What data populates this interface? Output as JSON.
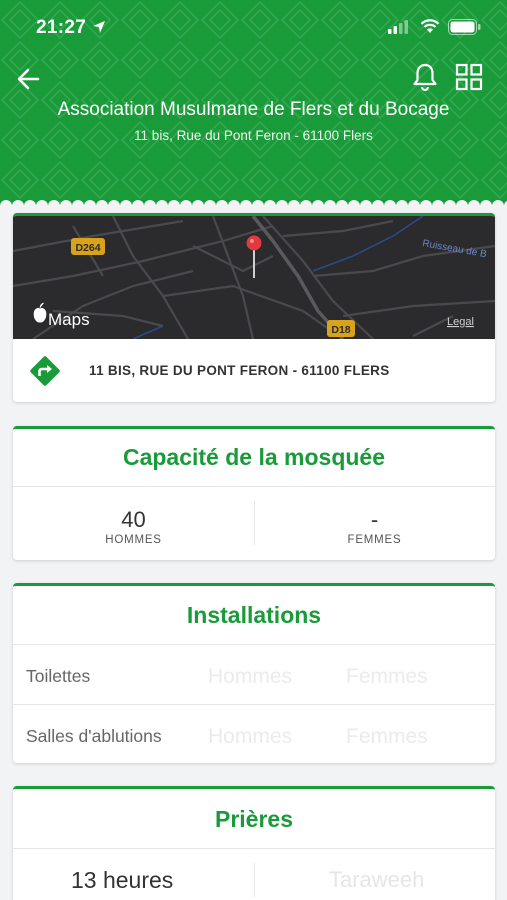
{
  "status_bar": {
    "time": "21:27"
  },
  "header": {
    "title": "Association Musulmane de Flers et du Bocage",
    "address": "11 bis, Rue du Pont Feron - 61100 Flers",
    "color": "#1a9b3a"
  },
  "icons": {
    "back": "arrow-left-icon",
    "notifications": "bell-icon",
    "menu": "grid-icon",
    "directions": "directions-icon"
  },
  "map": {
    "brand": "Maps",
    "legal": "Legal",
    "road_labels": [
      "D264",
      "D18"
    ],
    "water_label": "Ruisseau de B"
  },
  "location": {
    "address": "11 BIS, RUE DU PONT FERON - 61100 FLERS"
  },
  "capacity": {
    "title": "Capacité de la mosquée",
    "men_value": "40",
    "men_label": "HOMMES",
    "women_value": "-",
    "women_label": "FEMMES"
  },
  "facilities": {
    "title": "Installations",
    "rows": [
      {
        "label": "Toilettes",
        "men": "Hommes",
        "women": "Femmes"
      },
      {
        "label": "Salles d'ablutions",
        "men": "Hommes",
        "women": "Femmes"
      }
    ]
  },
  "prayers": {
    "title": "Prières",
    "hours": "13 heures",
    "taraweeh": "Taraweeh"
  }
}
